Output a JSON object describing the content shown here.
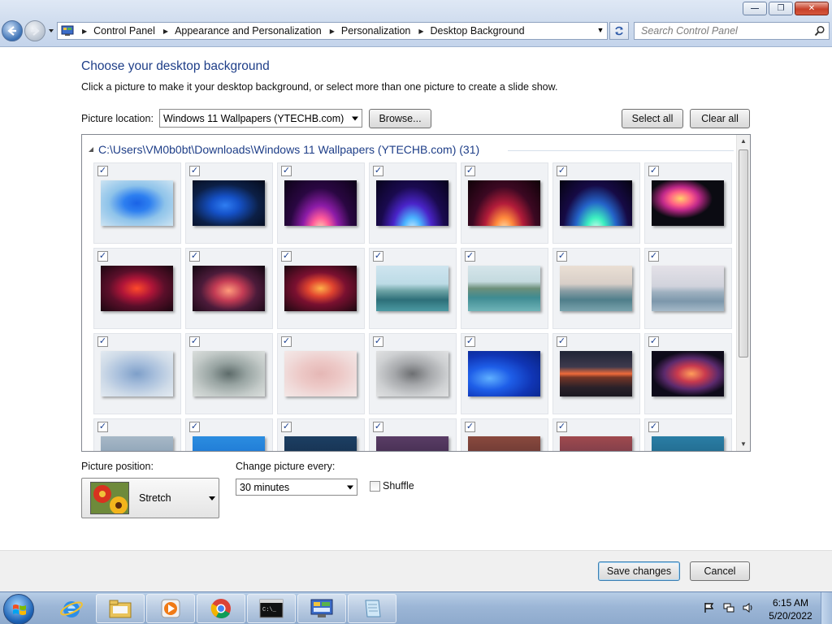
{
  "window": {
    "minimize_icon": "minimize-icon",
    "maximize_icon": "restore-icon",
    "close_icon": "close-icon"
  },
  "address": {
    "breadcrumbs": [
      "Control Panel",
      "Appearance and Personalization",
      "Personalization",
      "Desktop Background"
    ],
    "search_placeholder": "Search Control Panel"
  },
  "page": {
    "heading": "Choose your desktop background",
    "description": "Click a picture to make it your desktop background, or select more than one picture to create a slide show.",
    "picture_location_label": "Picture location:",
    "picture_location_value": "Windows 11 Wallpapers (YTECHB.com)",
    "browse_label": "Browse...",
    "select_all_label": "Select all",
    "clear_all_label": "Clear all"
  },
  "gallery": {
    "group_title": "C:\\Users\\VM0b0bt\\Downloads\\Windows 11 Wallpapers (YTECHB.com) (31)",
    "check_mark": "✓",
    "tiles": [
      {
        "style": "t-bloom-light",
        "checked": true
      },
      {
        "style": "t-bloom-dark",
        "checked": true
      },
      {
        "style": "t-glow-purple",
        "checked": true
      },
      {
        "style": "t-glow-blue",
        "checked": true
      },
      {
        "style": "t-glow-red",
        "checked": true
      },
      {
        "style": "t-glow-green",
        "checked": true
      },
      {
        "style": "t-flower",
        "checked": true
      },
      {
        "style": "t-abstract1",
        "checked": true
      },
      {
        "style": "t-abstract2",
        "checked": true
      },
      {
        "style": "t-abstract3",
        "checked": true
      },
      {
        "style": "t-lake1",
        "checked": true
      },
      {
        "style": "t-lake2",
        "checked": true
      },
      {
        "style": "t-lake3",
        "checked": true
      },
      {
        "style": "t-lake4",
        "checked": true
      },
      {
        "style": "t-silk-blue",
        "checked": true
      },
      {
        "style": "t-silk-grey",
        "checked": true
      },
      {
        "style": "t-silk-pink",
        "checked": true
      },
      {
        "style": "t-silk-white",
        "checked": true
      },
      {
        "style": "t-blue-swirl",
        "checked": true
      },
      {
        "style": "t-sunset",
        "checked": true
      },
      {
        "style": "t-ribbon",
        "checked": true
      },
      {
        "style": "t-r4a",
        "checked": true
      },
      {
        "style": "t-r4b",
        "checked": true
      },
      {
        "style": "t-r4c",
        "checked": true
      },
      {
        "style": "t-r4d",
        "checked": true
      },
      {
        "style": "t-r4e",
        "checked": true
      },
      {
        "style": "t-r4f",
        "checked": true
      },
      {
        "style": "t-r4g",
        "checked": true
      }
    ]
  },
  "options": {
    "position_label": "Picture position:",
    "position_value": "Stretch",
    "interval_label": "Change picture every:",
    "interval_value": "30 minutes",
    "shuffle_label": "Shuffle",
    "shuffle_checked": false
  },
  "footer": {
    "save_label": "Save changes",
    "cancel_label": "Cancel"
  },
  "taskbar": {
    "pinned": [
      "internet-explorer-icon",
      "file-explorer-icon",
      "media-player-icon",
      "chrome-icon",
      "command-prompt-icon",
      "control-panel-icon",
      "notepad-icon"
    ],
    "time": "6:15 AM",
    "date": "5/20/2022"
  },
  "colors": {
    "heading": "#1e3e88",
    "accent": "#3c7fb1"
  }
}
